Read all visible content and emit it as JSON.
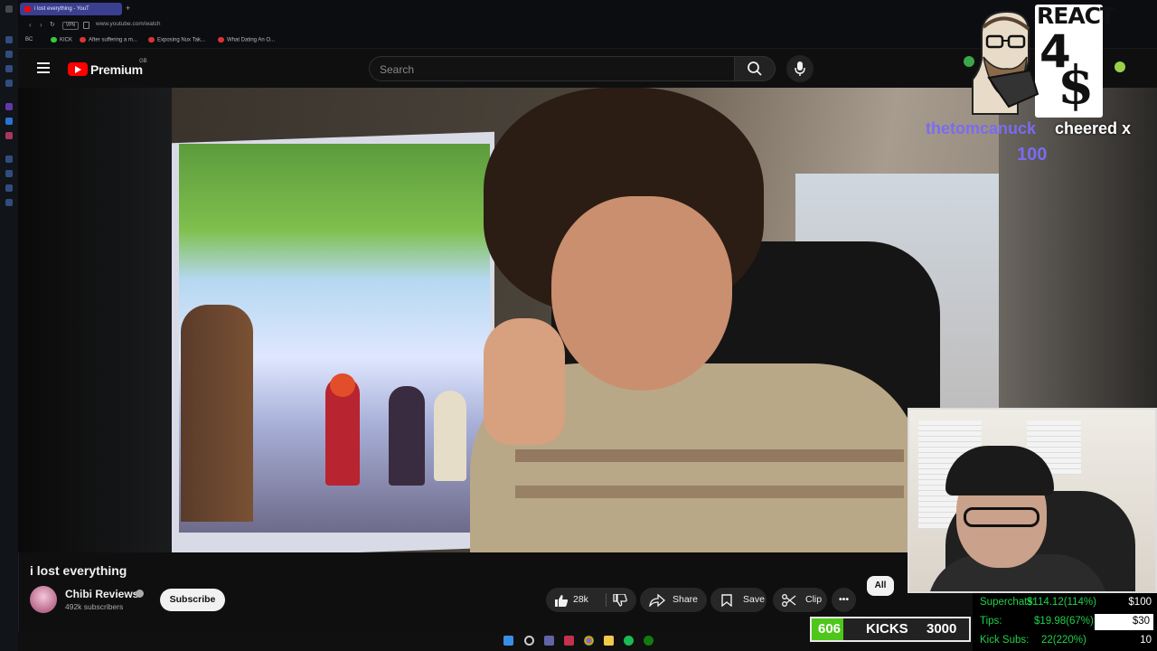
{
  "browser": {
    "active_tab_title": "i lost everything - YouT",
    "new_tab_symbol": "+",
    "url": "www.youtube.com/watch",
    "vpn_label": "VPN",
    "bookmarks": [
      "BC",
      "KICK",
      "After suffering a m...",
      "Exposing Nux Tak...",
      "What Dating An O..."
    ]
  },
  "youtube": {
    "logo_text": "Premium",
    "region_badge": "GB",
    "search_placeholder": "Search"
  },
  "video": {
    "title": "i lost everything",
    "channel_name": "Chibi Reviews",
    "subscribers": "492k subscribers",
    "subscribe_label": "Subscribe",
    "like_count": "28k",
    "share_label": "Share",
    "save_label": "Save",
    "clip_label": "Clip",
    "more_label": "•••",
    "filter_all_label": "All"
  },
  "overlay": {
    "react_title": "REACT",
    "react_number": "4",
    "react_symbol": "$",
    "cheer_user": "thetomcanuck",
    "cheer_text": "cheered x",
    "cheer_amount": "100",
    "kicks_current": "606",
    "kicks_label": "KICKS",
    "kicks_goal": "3000",
    "kicks_progress": 0.202,
    "stats": [
      {
        "label": "Superchats:",
        "value": "$114.12(114%)",
        "goal": "$100",
        "progress": 1.0
      },
      {
        "label": "Tips:",
        "value": "$19.98(67%)",
        "goal": "$30",
        "progress": 0.67
      },
      {
        "label": "Kick Subs:",
        "value": "22(220%)",
        "goal": "10",
        "progress": 1.0
      }
    ],
    "accent_green": "#1fd14a",
    "cheer_color": "#7a6cf0"
  },
  "taskbar": {
    "icons": [
      "windows-start-icon",
      "search-icon",
      "teams-icon",
      "app-icon",
      "chrome-icon",
      "file-explorer-icon",
      "spotify-icon",
      "xbox-icon"
    ]
  }
}
